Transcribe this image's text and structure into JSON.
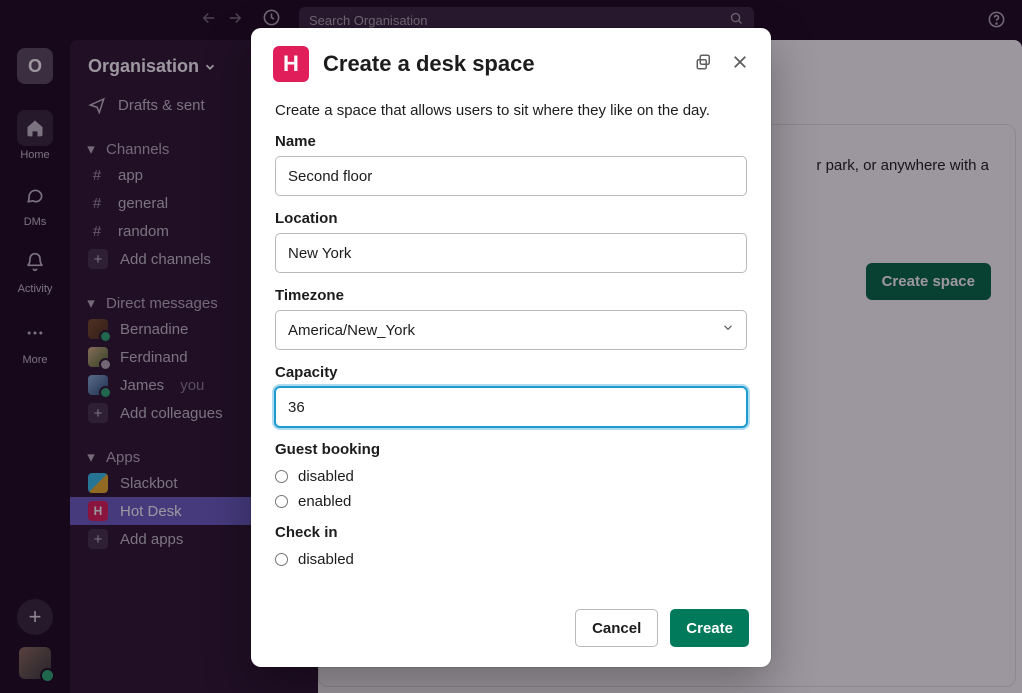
{
  "topbar": {
    "search_placeholder": "Search Organisation"
  },
  "rail": {
    "workspace_initial": "O",
    "home": "Home",
    "dms": "DMs",
    "activity": "Activity",
    "more": "More"
  },
  "sidebar": {
    "org_name": "Organisation",
    "drafts": "Drafts & sent",
    "channels_header": "Channels",
    "channels": [
      "app",
      "general",
      "random"
    ],
    "add_channels": "Add channels",
    "dms_header": "Direct messages",
    "dms": [
      {
        "name": "Bernadine",
        "color1": "#7b4f2a",
        "color2": "#4a2f1a",
        "presence": "#2bac76"
      },
      {
        "name": "Ferdinand",
        "color1": "#d9b38c",
        "color2": "#4a6f2a",
        "presence": "#b8afb9"
      },
      {
        "name": "James",
        "you": "you",
        "color1": "#8ab4d9",
        "color2": "#2a4f7b",
        "presence": "#2bac76"
      }
    ],
    "add_colleagues": "Add colleagues",
    "apps_header": "Apps",
    "apps": [
      {
        "name": "Slackbot",
        "badge_bg": "linear-gradient(135deg,#36c5f0 0 50%,#ecb22e 50% 100%)",
        "badge_text": ""
      },
      {
        "name": "Hot Desk",
        "badge_bg": "#e01e5a",
        "badge_text": "H",
        "selected": true
      }
    ],
    "add_apps": "Add apps"
  },
  "main": {
    "line": "r park, or anywhere with a",
    "create_space": "Create space"
  },
  "modal": {
    "brand_letter": "H",
    "title": "Create a desk space",
    "intro": "Create a space that allows users to sit where they like on the day.",
    "name_label": "Name",
    "name_value": "Second floor",
    "location_label": "Location",
    "location_value": "New York",
    "timezone_label": "Timezone",
    "timezone_value": "America/New_York",
    "capacity_label": "Capacity",
    "capacity_value": "36",
    "guest_label": "Guest booking",
    "guest_options": [
      "disabled",
      "enabled"
    ],
    "checkin_label": "Check in",
    "checkin_options": [
      "disabled"
    ],
    "cancel": "Cancel",
    "create": "Create"
  }
}
